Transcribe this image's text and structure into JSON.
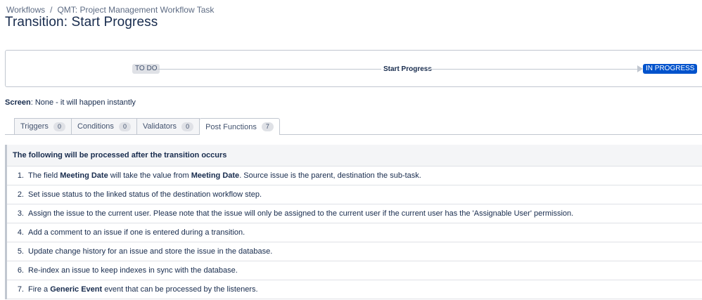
{
  "breadcrumb": {
    "items": [
      "Workflows",
      "QMT: Project Management Workflow Task"
    ],
    "separator": "/"
  },
  "page_title": "Transition: Start Progress",
  "diagram": {
    "from_status": "TO DO",
    "transition_name": "Start Progress",
    "to_status": "IN PROGRESS",
    "from_status_color": "#dfe1e6",
    "to_status_color": "#0052cc"
  },
  "screen": {
    "label": "Screen",
    "value": ": None - it will happen instantly"
  },
  "tabs": [
    {
      "label": "Triggers",
      "count": "0",
      "active": false
    },
    {
      "label": "Conditions",
      "count": "0",
      "active": false
    },
    {
      "label": "Validators",
      "count": "0",
      "active": false
    },
    {
      "label": "Post Functions",
      "count": "7",
      "active": true
    }
  ],
  "post_functions": {
    "header": "The following will be processed after the transition occurs",
    "items": [
      {
        "num": "1.",
        "parts": [
          {
            "t": "The field "
          },
          {
            "t": "Meeting Date",
            "b": true
          },
          {
            "t": " will take the value from "
          },
          {
            "t": "Meeting Date",
            "b": true
          },
          {
            "t": ". Source issue is the parent, destination the sub-task."
          }
        ]
      },
      {
        "num": "2.",
        "parts": [
          {
            "t": "Set issue status to the linked status of the destination workflow step."
          }
        ]
      },
      {
        "num": "3.",
        "parts": [
          {
            "t": "Assign the issue to the current user. Please note that the issue will only be assigned to the current user if the current user has the 'Assignable User' permission."
          }
        ]
      },
      {
        "num": "4.",
        "parts": [
          {
            "t": "Add a comment to an issue if one is entered during a transition."
          }
        ]
      },
      {
        "num": "5.",
        "parts": [
          {
            "t": "Update change history for an issue and store the issue in the database."
          }
        ]
      },
      {
        "num": "6.",
        "parts": [
          {
            "t": "Re-index an issue to keep indexes in sync with the database."
          }
        ]
      },
      {
        "num": "7.",
        "parts": [
          {
            "t": "Fire a "
          },
          {
            "t": "Generic Event",
            "b": true
          },
          {
            "t": " event that can be processed by the listeners."
          }
        ]
      }
    ]
  }
}
